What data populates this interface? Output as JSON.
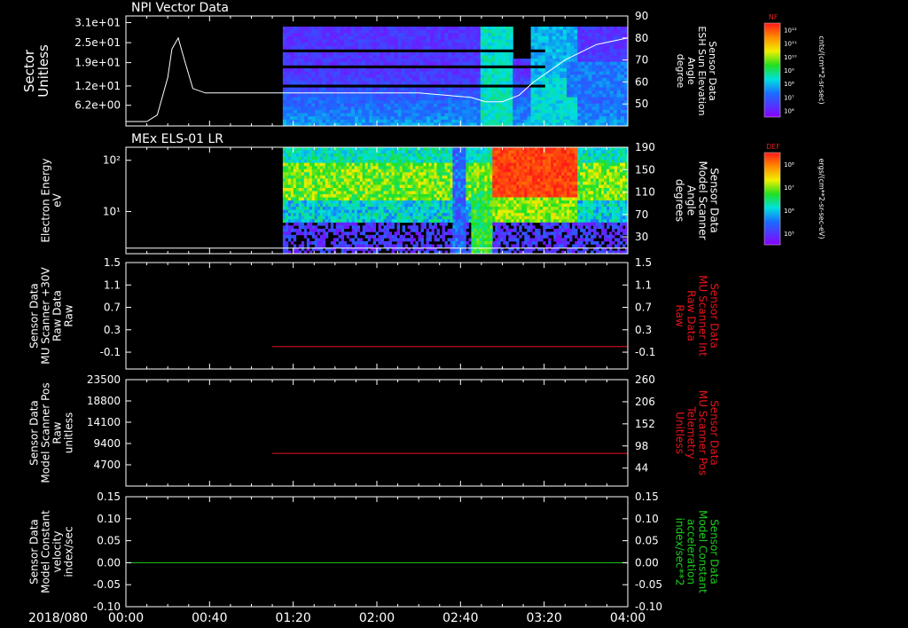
{
  "time_axis": {
    "date_label": "2018/080",
    "ticks": [
      "00:00",
      "00:40",
      "01:20",
      "02:00",
      "02:40",
      "03:20",
      "04:00"
    ],
    "range_minutes": [
      0,
      240
    ]
  },
  "colors": {
    "background": "#000000",
    "axis": "#ffffff",
    "red_series": "#e8141c",
    "green_series": "#1ecf1e"
  },
  "colorbars": [
    {
      "title": "NF",
      "units": "cnts/(cm**2-sr-sec)",
      "tick_labels": [
        "10¹²",
        "10¹¹",
        "10¹⁰",
        "10⁹",
        "10⁸",
        "10⁷",
        "10⁶"
      ]
    },
    {
      "title": "DEF",
      "units": "ergs/(cm**2-sr-sec-eV)",
      "tick_labels": [
        "10⁸",
        "10⁷",
        "10⁶",
        "10⁵"
      ]
    }
  ],
  "chart_data": [
    {
      "type": "heatmap",
      "title": "NPI Vector Data",
      "ylabel": [
        "Sector",
        "Unitless"
      ],
      "y_ticks": [
        "3.1e+01",
        "2.5e+01",
        "1.9e+01",
        "1.2e+01",
        "6.2e+00"
      ],
      "y_tick_values": [
        31,
        25,
        19,
        12,
        6.2
      ],
      "ylim": [
        0,
        33
      ],
      "data_start_minutes": 75,
      "right_axis": {
        "label": [
          "Sensor Data",
          "ESH Sun Elevation",
          "Angle",
          "degree"
        ],
        "ticks": [
          "90",
          "80",
          "70",
          "60",
          "50"
        ],
        "tick_values": [
          90,
          80,
          70,
          60,
          50
        ],
        "ylim": [
          40,
          90
        ]
      },
      "line_series": {
        "axis": "right",
        "x_minutes": [
          0,
          10,
          15,
          20,
          22,
          25,
          28,
          32,
          38,
          60,
          75,
          100,
          140,
          165,
          172,
          180,
          188,
          195,
          210,
          225,
          240
        ],
        "values": [
          42,
          42,
          45,
          62,
          75,
          80,
          70,
          57,
          55,
          55,
          55,
          55,
          55,
          53,
          51,
          51,
          54,
          60,
          70,
          77,
          80
        ]
      }
    },
    {
      "type": "heatmap",
      "title": "MEx ELS-01 LR",
      "ylabel": [
        "Electron Energy",
        "eV"
      ],
      "y_ticks": [
        "10²",
        "10¹"
      ],
      "y_tick_values": [
        100,
        10
      ],
      "ylim_log": [
        1.5,
        180
      ],
      "data_start_minutes": 75,
      "right_axis": {
        "label": [
          "Sensor Data",
          "Model Scanner",
          "Angle",
          "degrees"
        ],
        "ticks": [
          "190",
          "150",
          "110",
          "70",
          "30"
        ],
        "tick_values": [
          190,
          150,
          110,
          70,
          30
        ],
        "ylim": [
          0,
          190
        ]
      },
      "line_series": {
        "axis": "right",
        "x_minutes": [
          0,
          240
        ],
        "values": [
          10,
          10
        ]
      }
    },
    {
      "type": "line",
      "ylabel": [
        "Sensor Data",
        "MU Scanner +30V",
        "Raw Data",
        "Raw"
      ],
      "y_ticks": [
        "1.5",
        "1.1",
        "0.7",
        "0.3",
        "-0.1"
      ],
      "y_tick_values": [
        1.5,
        1.1,
        0.7,
        0.3,
        -0.1
      ],
      "ylim": [
        -0.4,
        1.5
      ],
      "right_axis": {
        "label": [
          "Sensor Data",
          "MU Scanner Int",
          "Raw Data",
          "Raw"
        ],
        "ticks": [
          "1.5",
          "1.1",
          "0.7",
          "0.3",
          "-0.1"
        ],
        "tick_values": [
          1.5,
          1.1,
          0.7,
          0.3,
          -0.1
        ],
        "ylim": [
          -0.4,
          1.5
        ],
        "label_color": "red"
      },
      "series": [
        {
          "axis": "right",
          "color": "red",
          "x_minutes": [
            70,
            240
          ],
          "values": [
            0.0,
            0.0
          ]
        }
      ]
    },
    {
      "type": "line",
      "ylabel": [
        "Sensor Data",
        "Model Scanner Pos",
        "Raw",
        "unitless"
      ],
      "y_ticks": [
        "23500",
        "18800",
        "14100",
        "9400",
        "4700"
      ],
      "y_tick_values": [
        23500,
        18800,
        14100,
        9400,
        4700
      ],
      "ylim": [
        0,
        23500
      ],
      "right_axis": {
        "label": [
          "Sensor Data",
          "MU Scanner Pos",
          "Telemetry",
          "Unitless"
        ],
        "ticks": [
          "260",
          "206",
          "152",
          "98",
          "44"
        ],
        "tick_values": [
          260,
          206,
          152,
          98,
          44
        ],
        "ylim": [
          0,
          260
        ],
        "label_color": "red"
      },
      "series": [
        {
          "axis": "right",
          "color": "red",
          "x_minutes": [
            70,
            240
          ],
          "values": [
            80,
            80
          ]
        }
      ]
    },
    {
      "type": "line",
      "ylabel": [
        "Sensor Data",
        "Model Constant",
        "velocity",
        "index/sec"
      ],
      "y_ticks": [
        "0.15",
        "0.10",
        "0.05",
        "0.00",
        "-0.05",
        "-0.10"
      ],
      "y_tick_values": [
        0.15,
        0.1,
        0.05,
        0.0,
        -0.05,
        -0.1
      ],
      "ylim": [
        -0.1,
        0.15
      ],
      "right_axis": {
        "label": [
          "Sensor Data",
          "Model Constant",
          "acceleration",
          "index/sec**2"
        ],
        "ticks": [
          "0.15",
          "0.10",
          "0.05",
          "0.00",
          "-0.05",
          "-0.10"
        ],
        "tick_values": [
          0.15,
          0.1,
          0.05,
          0.0,
          -0.05,
          -0.1
        ],
        "ylim": [
          -0.1,
          0.15
        ],
        "label_color": "green"
      },
      "series": [
        {
          "axis": "right",
          "color": "green",
          "x_minutes": [
            0,
            240
          ],
          "values": [
            0.0,
            0.0
          ]
        }
      ]
    }
  ]
}
